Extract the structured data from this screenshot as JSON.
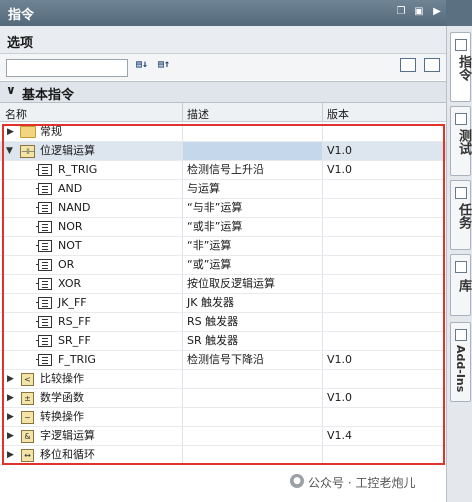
{
  "window": {
    "title": "指令"
  },
  "options": {
    "header": "选项",
    "search_placeholder": ""
  },
  "section": {
    "title": "基本指令"
  },
  "columns": {
    "name": "名称",
    "desc": "描述",
    "version": "版本"
  },
  "rows": [
    {
      "name": "常规",
      "desc": "",
      "version": ""
    },
    {
      "name": "位逻辑运算",
      "desc": "",
      "version": "V1.0"
    },
    {
      "name": "R_TRIG",
      "desc": "检测信号上升沿",
      "version": "V1.0"
    },
    {
      "name": "AND",
      "desc": "与运算",
      "version": ""
    },
    {
      "name": "NAND",
      "desc": "“与非”运算",
      "version": ""
    },
    {
      "name": "NOR",
      "desc": "“或非”运算",
      "version": ""
    },
    {
      "name": "NOT",
      "desc": "“非”运算",
      "version": ""
    },
    {
      "name": "OR",
      "desc": "“或”运算",
      "version": ""
    },
    {
      "name": "XOR",
      "desc": "按位取反逻辑运算",
      "version": ""
    },
    {
      "name": "JK_FF",
      "desc": "JK 触发器",
      "version": ""
    },
    {
      "name": "RS_FF",
      "desc": "RS 触发器",
      "version": ""
    },
    {
      "name": "SR_FF",
      "desc": "SR 触发器",
      "version": ""
    },
    {
      "name": "F_TRIG",
      "desc": "检测信号下降沿",
      "version": "V1.0"
    },
    {
      "name": "比较操作",
      "desc": "",
      "version": ""
    },
    {
      "name": "数学函数",
      "desc": "",
      "version": "V1.0"
    },
    {
      "name": "转换操作",
      "desc": "",
      "version": ""
    },
    {
      "name": "字逻辑运算",
      "desc": "",
      "version": "V1.4"
    },
    {
      "name": "移位和循环",
      "desc": "",
      "version": ""
    }
  ],
  "right_tabs": {
    "instructions": "指令",
    "test": "测试",
    "tasks": "任务",
    "library": "库",
    "addins": "Add-Ins"
  },
  "watermark": "公众号 · 工控老炮儿",
  "colors": {
    "title_bar": "#5b7182",
    "highlight_box": "#e0332e",
    "selected_row": "#c5d7ea"
  }
}
